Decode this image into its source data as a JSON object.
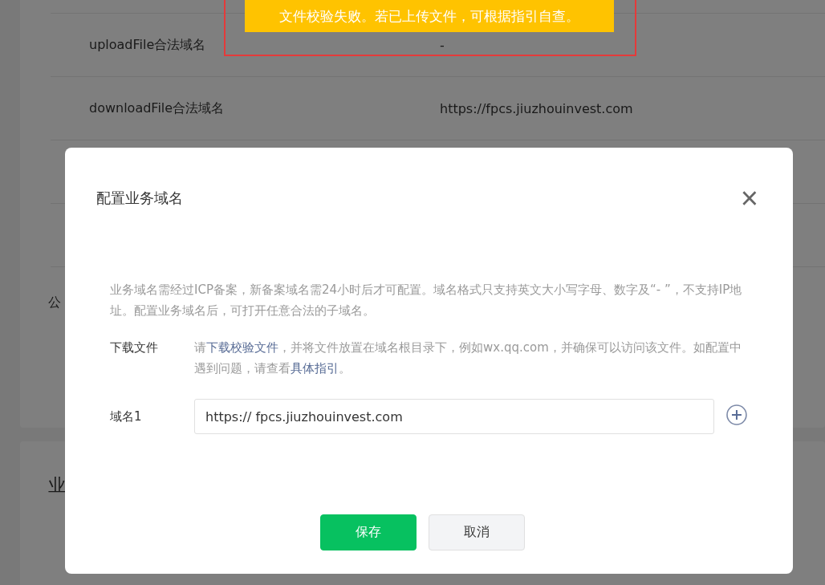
{
  "page": {
    "domain_rows": [
      {
        "label": "uploadFile合法域名",
        "value": "-"
      },
      {
        "label": "downloadFile合法域名",
        "value": "https://fpcs.jiuzhouinvest.com"
      }
    ],
    "partial_row_label": "公",
    "section_heading": "业"
  },
  "toast": {
    "message": "文件校验失败。若已上传文件，可根据指引自查。"
  },
  "dialog": {
    "title": "配置业务域名",
    "close": "×",
    "description": "业务域名需经过ICP备案，新备案域名需24小时后才可配置。域名格式只支持英文大小写字母、数字及“- ”，不支持IP地址。配置业务域名后，可打开任意合法的子域名。",
    "download": {
      "label": "下载文件",
      "before": "请",
      "link1": "下载校验文件",
      "middle": "，并将文件放置在域名根目录下，例如wx.qq.com，并确保可以访问该文件。如配置中遇到问题，请查看",
      "link2": "具体指引",
      "after": "。"
    },
    "domains": [
      {
        "label": "域名1",
        "value": "https:// fpcs.jiuzhouinvest.com"
      }
    ],
    "buttons": [
      {
        "label": "保存",
        "kind": "primary"
      },
      {
        "label": "取消",
        "kind": "default"
      }
    ]
  }
}
